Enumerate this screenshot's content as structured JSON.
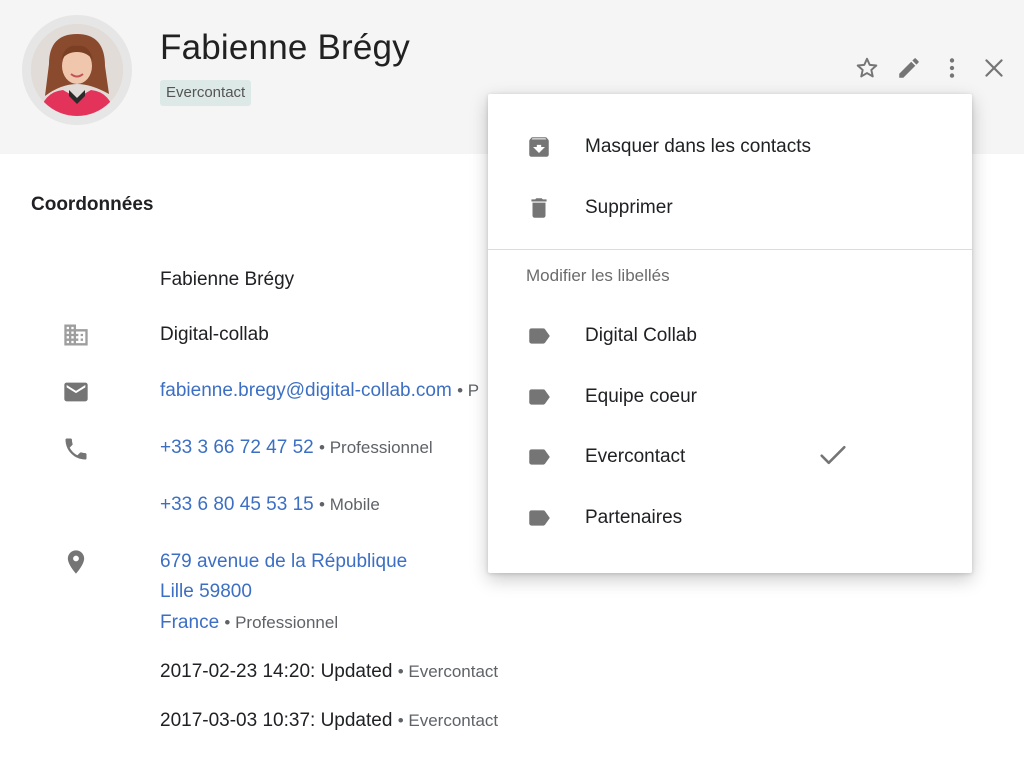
{
  "contact": {
    "name": "Fabienne Brégy",
    "label_chip": "Evercontact"
  },
  "header_actions": [
    {
      "icon": "star-icon"
    },
    {
      "icon": "edit-icon"
    },
    {
      "icon": "more-vert-icon"
    },
    {
      "icon": "close-icon"
    }
  ],
  "details": {
    "section_title": "Coordonnées",
    "full_name": "Fabienne Brégy",
    "company": "Digital-collab",
    "email": "fabienne.bregy@digital-collab.com",
    "email_type": "• P",
    "phone1": "+33 3 66 72 47 52",
    "phone1_type": "• Professionnel",
    "phone2": "+33 6 80 45 53 15",
    "phone2_type": "• Mobile",
    "address_line1": "679 avenue de la République",
    "address_line2": "Lille 59800",
    "address_line3": "France",
    "address_type": "• Professionnel",
    "history": [
      {
        "text": "2017-02-23 14:20: Updated",
        "source": "• Evercontact"
      },
      {
        "text": "2017-03-03 10:37: Updated",
        "source": "• Evercontact"
      }
    ]
  },
  "menu": {
    "actions": [
      {
        "label": "Masquer dans les contacts",
        "icon": "archive-icon"
      },
      {
        "label": "Supprimer",
        "icon": "trash-icon"
      }
    ],
    "labels_header": "Modifier les libellés",
    "labels": [
      {
        "label": "Digital Collab",
        "checked": false
      },
      {
        "label": "Equipe coeur",
        "checked": false
      },
      {
        "label": "Evercontact",
        "checked": true
      },
      {
        "label": "Partenaires",
        "checked": false
      }
    ]
  },
  "colors": {
    "link": "#3c6fc4",
    "header_bg": "#f5f5f5",
    "chip_bg": "#dde9e7",
    "icon_gray": "#757575"
  }
}
